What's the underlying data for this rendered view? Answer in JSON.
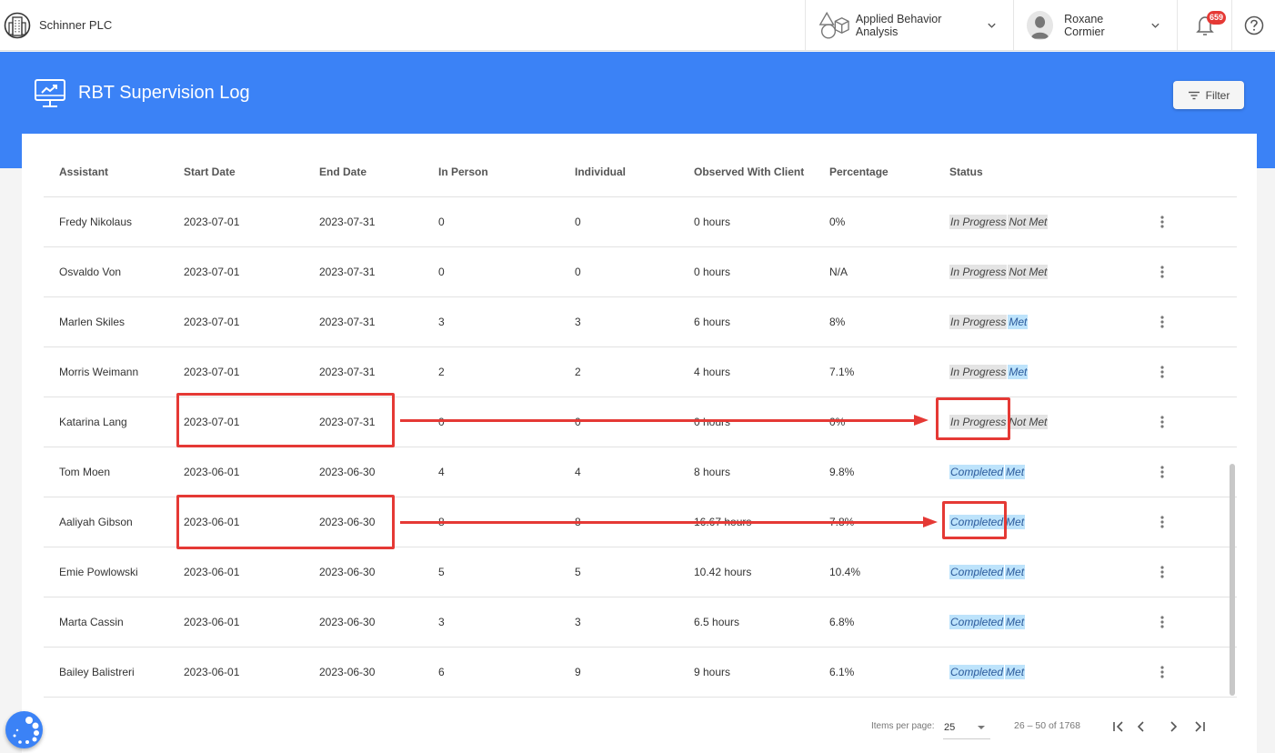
{
  "topbar": {
    "org_name": "Schinner PLC",
    "app_selector": "Applied Behavior Analysis",
    "user_name": "Roxane Cormier",
    "notification_count": "659"
  },
  "page": {
    "title": "RBT Supervision Log",
    "filter_label": "Filter"
  },
  "table": {
    "columns": [
      "Assistant",
      "Start Date",
      "End Date",
      "In Person",
      "Individual",
      "Observed With Client",
      "Percentage",
      "Status"
    ],
    "rows": [
      {
        "assistant": "Fredy Nikolaus",
        "start": "2023-07-01",
        "end": "2023-07-31",
        "in_person": "0",
        "individual": "0",
        "observed": "0 hours",
        "percentage": "0%",
        "status": "In Progress",
        "met": "Not Met"
      },
      {
        "assistant": "Osvaldo Von",
        "start": "2023-07-01",
        "end": "2023-07-31",
        "in_person": "0",
        "individual": "0",
        "observed": "0 hours",
        "percentage": "N/A",
        "status": "In Progress",
        "met": "Not Met"
      },
      {
        "assistant": "Marlen Skiles",
        "start": "2023-07-01",
        "end": "2023-07-31",
        "in_person": "3",
        "individual": "3",
        "observed": "6 hours",
        "percentage": "8%",
        "status": "In Progress",
        "met": "Met"
      },
      {
        "assistant": "Morris Weimann",
        "start": "2023-07-01",
        "end": "2023-07-31",
        "in_person": "2",
        "individual": "2",
        "observed": "4 hours",
        "percentage": "7.1%",
        "status": "In Progress",
        "met": "Met"
      },
      {
        "assistant": "Katarina Lang",
        "start": "2023-07-01",
        "end": "2023-07-31",
        "in_person": "0",
        "individual": "0",
        "observed": "0 hours",
        "percentage": "0%",
        "status": "In Progress",
        "met": "Not Met"
      },
      {
        "assistant": "Tom Moen",
        "start": "2023-06-01",
        "end": "2023-06-30",
        "in_person": "4",
        "individual": "4",
        "observed": "8 hours",
        "percentage": "9.8%",
        "status": "Completed",
        "met": "Met"
      },
      {
        "assistant": "Aaliyah Gibson",
        "start": "2023-06-01",
        "end": "2023-06-30",
        "in_person": "8",
        "individual": "8",
        "observed": "16.67 hours",
        "percentage": "7.8%",
        "status": "Completed",
        "met": "Met"
      },
      {
        "assistant": "Emie Powlowski",
        "start": "2023-06-01",
        "end": "2023-06-30",
        "in_person": "5",
        "individual": "5",
        "observed": "10.42 hours",
        "percentage": "10.4%",
        "status": "Completed",
        "met": "Met"
      },
      {
        "assistant": "Marta Cassin",
        "start": "2023-06-01",
        "end": "2023-06-30",
        "in_person": "3",
        "individual": "3",
        "observed": "6.5 hours",
        "percentage": "6.8%",
        "status": "Completed",
        "met": "Met"
      },
      {
        "assistant": "Bailey Balistreri",
        "start": "2023-06-01",
        "end": "2023-06-30",
        "in_person": "6",
        "individual": "9",
        "observed": "9 hours",
        "percentage": "6.1%",
        "status": "Completed",
        "met": "Met"
      }
    ]
  },
  "pagination": {
    "items_per_page_label": "Items per page:",
    "items_per_page": "25",
    "range": "26 – 50 of 1768"
  },
  "colors": {
    "brand_blue": "#3b82f6",
    "annotation_red": "#e53935",
    "status_grey": "#e4e4e4",
    "status_blue": "#bde3fb"
  }
}
